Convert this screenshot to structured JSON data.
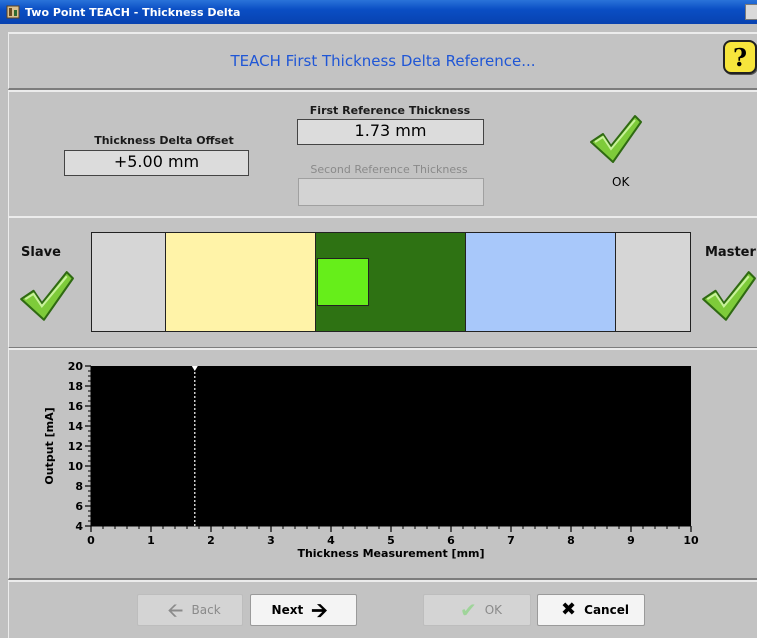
{
  "window": {
    "title": "Two Point TEACH - Thickness Delta"
  },
  "header": {
    "heading": "TEACH First Thickness Delta Reference...",
    "help_label": "?"
  },
  "info": {
    "offset_label": "Thickness Delta Offset",
    "offset_value": "+5.00 mm",
    "first_ref_label": "First Reference Thickness",
    "first_ref_value": "1.73 mm",
    "second_ref_label": "Second Reference Thickness",
    "second_ref_value": "",
    "ok_label": "OK"
  },
  "zones": {
    "slave_label": "Slave",
    "master_label": "Master",
    "segments": [
      "#d6d6d6",
      "#fff3a8",
      "#2e7213",
      "#a8c8fa",
      "#d6d6d6"
    ],
    "indicator_color": "#66ee1a"
  },
  "chart_data": {
    "type": "line",
    "xlabel": "Thickness Measurement [mm]",
    "ylabel": "Output [mA]",
    "xlim": [
      0,
      10
    ],
    "ylim": [
      4,
      20
    ],
    "x_ticks": [
      0,
      1,
      2,
      3,
      4,
      5,
      6,
      7,
      8,
      9,
      10
    ],
    "y_ticks": [
      4,
      6,
      8,
      10,
      12,
      14,
      16,
      18,
      20
    ],
    "marker_x": 1.73,
    "background": "#000000",
    "marker_color": "#ffffff"
  },
  "buttons": {
    "back": "Back",
    "next": "Next",
    "ok": "OK",
    "cancel": "Cancel"
  }
}
